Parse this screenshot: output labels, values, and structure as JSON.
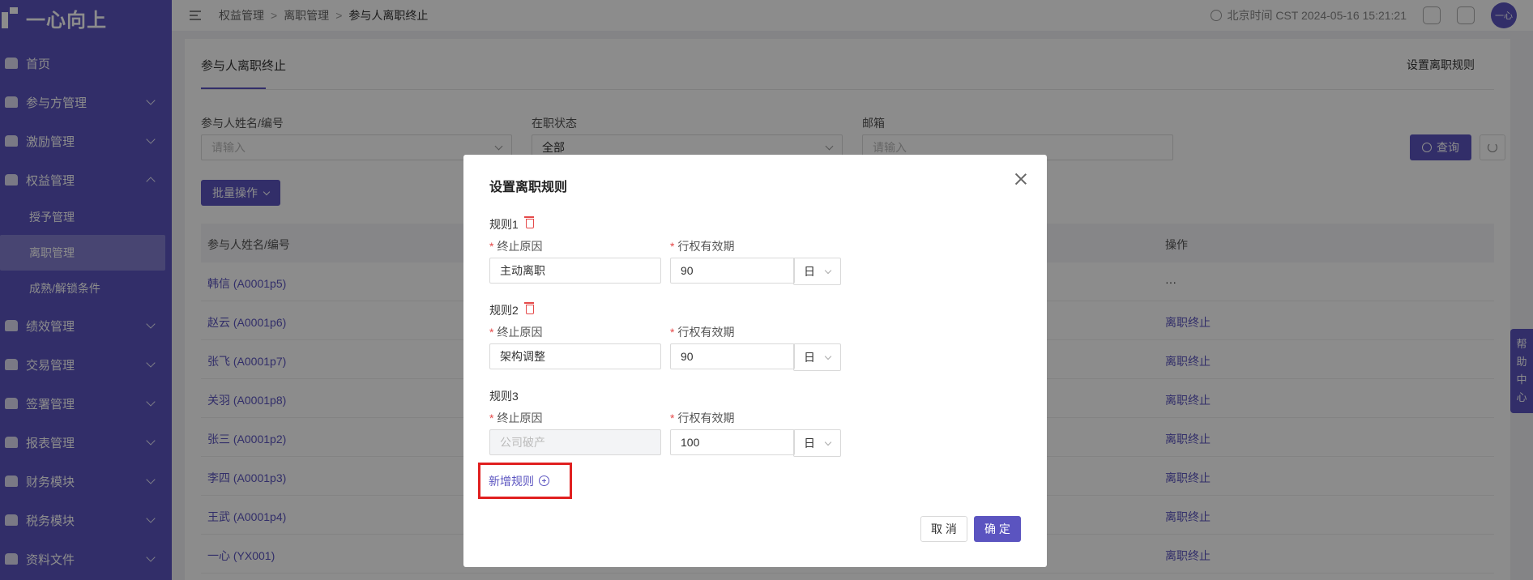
{
  "app": {
    "logo_text": "一心向上"
  },
  "sidebar": {
    "items": [
      {
        "label": "首页",
        "has_chevron": false
      },
      {
        "label": "参与方管理",
        "has_chevron": true
      },
      {
        "label": "激励管理",
        "has_chevron": true
      },
      {
        "label": "权益管理",
        "has_chevron": true,
        "expanded": true
      },
      {
        "label": "绩效管理",
        "has_chevron": true
      },
      {
        "label": "交易管理",
        "has_chevron": true
      },
      {
        "label": "签署管理",
        "has_chevron": true
      },
      {
        "label": "报表管理",
        "has_chevron": true
      },
      {
        "label": "财务模块",
        "has_chevron": true
      },
      {
        "label": "税务模块",
        "has_chevron": true
      },
      {
        "label": "资料文件",
        "has_chevron": true
      }
    ],
    "sub_items": [
      {
        "label": "授予管理",
        "active": false
      },
      {
        "label": "离职管理",
        "active": true
      },
      {
        "label": "成熟/解锁条件",
        "active": false
      }
    ]
  },
  "header": {
    "breadcrumb": [
      "权益管理",
      "离职管理",
      "参与人离职终止"
    ],
    "time_text": "北京时间 CST 2024-05-16 15:21:21",
    "avatar_text": "一心"
  },
  "page": {
    "tab_label": "参与人离职终止",
    "rule_link": "设置离职规则",
    "filters": {
      "name_label": "参与人姓名/编号",
      "name_placeholder": "请输入",
      "status_label": "在职状态",
      "status_value": "全部",
      "email_label": "邮箱",
      "email_placeholder": "请输入"
    },
    "query_button": "查询",
    "batch_button": "批量操作",
    "table": {
      "columns": [
        "参与人姓名/编号",
        "操作"
      ],
      "rows": [
        {
          "name": "韩信 (A0001p5)",
          "action": "···"
        },
        {
          "name": "赵云 (A0001p6)",
          "action": "离职终止"
        },
        {
          "name": "张飞 (A0001p7)",
          "action": "离职终止"
        },
        {
          "name": "关羽 (A0001p8)",
          "action": "离职终止"
        },
        {
          "name": "张三 (A0001p2)",
          "action": "离职终止"
        },
        {
          "name": "李四 (A0001p3)",
          "action": "离职终止"
        },
        {
          "name": "王武 (A0001p4)",
          "action": "离职终止"
        },
        {
          "name": "一心 (YX001)",
          "action": "离职终止"
        }
      ]
    },
    "help_tab": "帮助中心"
  },
  "modal": {
    "title": "设置离职规则",
    "rules": [
      {
        "title": "规则1",
        "deletable": true,
        "reason_label": "终止原因",
        "reason_value": "主动离职",
        "reason_disabled": false,
        "period_label": "行权有效期",
        "period_value": "90",
        "unit": "日"
      },
      {
        "title": "规则2",
        "deletable": true,
        "reason_label": "终止原因",
        "reason_value": "架构调整",
        "reason_disabled": false,
        "period_label": "行权有效期",
        "period_value": "90",
        "unit": "日"
      },
      {
        "title": "规则3",
        "deletable": false,
        "reason_label": "终止原因",
        "reason_value": "公司破产",
        "reason_disabled": true,
        "period_label": "行权有效期",
        "period_value": "100",
        "unit": "日"
      }
    ],
    "add_rule": "新增规则",
    "cancel": "取 消",
    "ok": "确 定"
  },
  "colors": {
    "primary": "#5b54c0",
    "danger": "#e54a4a",
    "highlight": "#e02020"
  }
}
